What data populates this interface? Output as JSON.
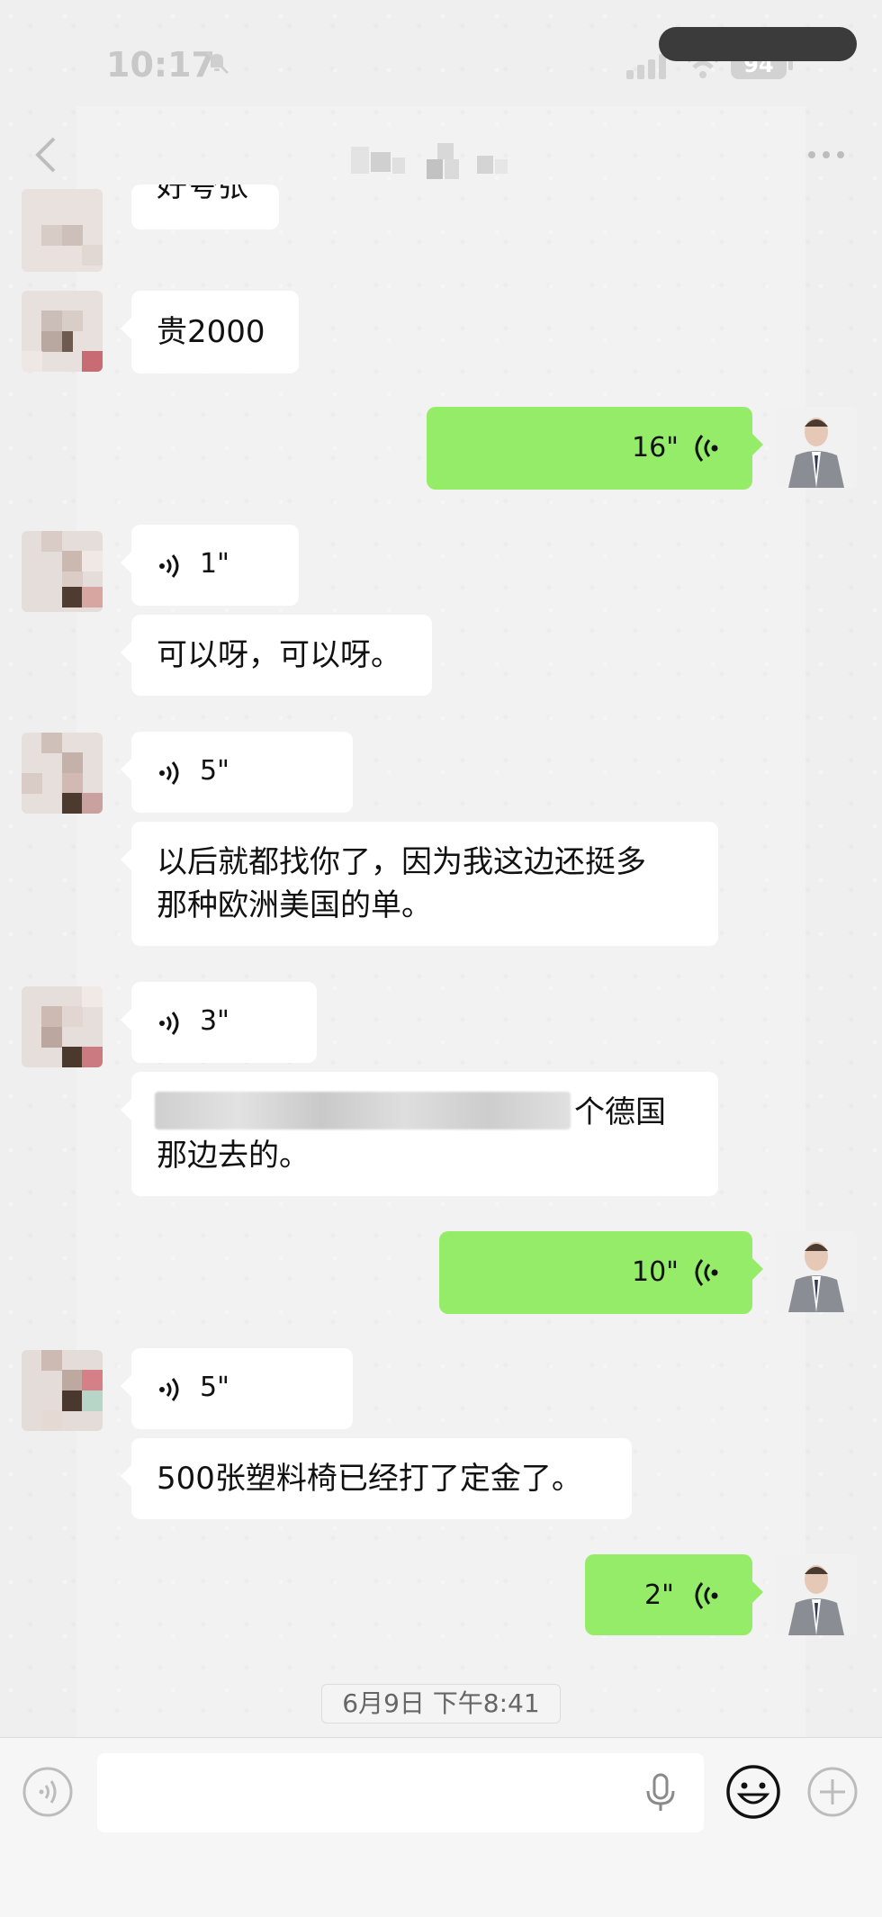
{
  "status_bar": {
    "time": "10:17",
    "battery": "94"
  },
  "chat": {
    "messages": [
      {
        "kind": "text",
        "from": "other",
        "text": "好夸张"
      },
      {
        "kind": "text",
        "from": "other",
        "text": "贵2000"
      },
      {
        "kind": "voice",
        "from": "me",
        "duration": "16\""
      },
      {
        "kind": "voice",
        "from": "other",
        "duration": "1\""
      },
      {
        "kind": "text",
        "from": "other",
        "text": "可以呀，可以呀。"
      },
      {
        "kind": "voice",
        "from": "other",
        "duration": "5\""
      },
      {
        "kind": "text",
        "from": "other",
        "lines": [
          "以后就都找你了，因为我这边还挺多",
          "那种欧洲美国的单。"
        ]
      },
      {
        "kind": "voice",
        "from": "other",
        "duration": "3\""
      },
      {
        "kind": "text",
        "from": "other",
        "lines": [
          "个德国",
          "那边去的。"
        ]
      },
      {
        "kind": "voice",
        "from": "me",
        "duration": "10\""
      },
      {
        "kind": "voice",
        "from": "other",
        "duration": "5\""
      },
      {
        "kind": "text",
        "from": "other",
        "text": "500张塑料椅已经打了定金了。"
      },
      {
        "kind": "voice",
        "from": "me",
        "duration": "2\""
      }
    ],
    "timestamp": "6月9日 下午8:41"
  },
  "colors": {
    "sent_bubble": "#95ec69",
    "received_bubble": "#ffffff",
    "background": "#ededed"
  },
  "icons": [
    "back-icon",
    "more-icon",
    "voice-icon",
    "mic-icon",
    "emoji-icon",
    "plus-icon"
  ]
}
